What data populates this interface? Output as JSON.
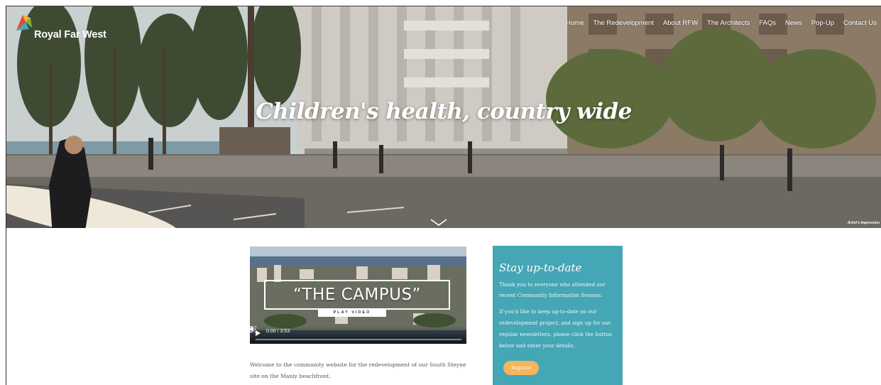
{
  "brand": {
    "name": "Royal Far West"
  },
  "nav": {
    "items": [
      {
        "label": "Home"
      },
      {
        "label": "The Redevelopment"
      },
      {
        "label": "About RFW"
      },
      {
        "label": "The Architects"
      },
      {
        "label": "FAQs"
      },
      {
        "label": "News"
      },
      {
        "label": "Pop-Up"
      },
      {
        "label": "Contact Us"
      }
    ]
  },
  "hero": {
    "title": "Children's health, country wide",
    "caption": "Artist's Impression"
  },
  "video": {
    "title": "“THE CAMPUS”",
    "subtitle": "PLAY VIDEO",
    "time": "0:00 / 3:53"
  },
  "main": {
    "welcome": "Welcome to the community website for the redevelopment of our South Steyne site on the Manly beachfront."
  },
  "panel": {
    "title": "Stay up-to-date",
    "p1": "Thank you to everyone who attended our recent Community Information Session.",
    "p2": "If you'd like to keep up-to-date on our redevelopment project, and sign up for our regular newsletters, please click the button below and enter your details.",
    "button": "Register",
    "bg_color": "#45a6b5",
    "button_color": "#f3b65c"
  },
  "icons": [
    "logo-mark-icon",
    "chevron-down-icon",
    "play-icon",
    "volume-icon",
    "fullscreen-icon",
    "more-options-icon"
  ]
}
